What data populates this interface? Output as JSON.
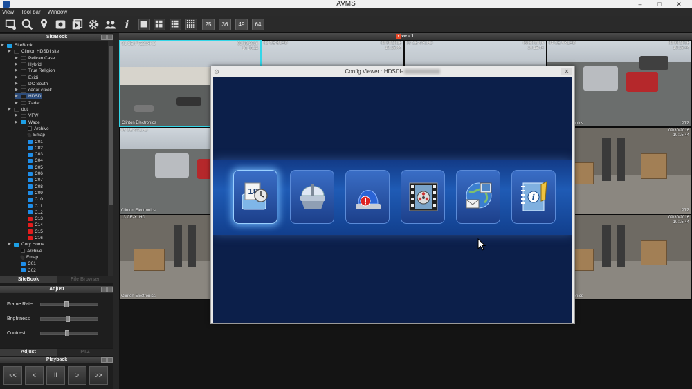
{
  "window": {
    "title": "AVMS",
    "controls": [
      "–",
      "□",
      "✕"
    ]
  },
  "menu": [
    "View",
    "Tool bar",
    "Window"
  ],
  "toolbar": {
    "icons": [
      "monitor-icon",
      "search-icon",
      "location-pin-icon",
      "archive-icon",
      "playback-icon",
      "gear-icon",
      "users-icon",
      "info-icon"
    ],
    "layout_counts": [
      "25",
      "36",
      "49",
      "64"
    ]
  },
  "sitebook": {
    "header": "SiteBook",
    "tree": [
      {
        "label": "SiteBook",
        "level": 0,
        "kind": "folder-blue"
      },
      {
        "label": "Clinton HDSDI site",
        "level": 1,
        "kind": "folder"
      },
      {
        "label": "Pelican Case",
        "level": 2,
        "kind": "folder"
      },
      {
        "label": "Hybrid",
        "level": 2,
        "kind": "folder"
      },
      {
        "label": "True Religion",
        "level": 2,
        "kind": "folder"
      },
      {
        "label": "Exidi",
        "level": 2,
        "kind": "folder"
      },
      {
        "label": "DC South",
        "level": 2,
        "kind": "folder"
      },
      {
        "label": "cedar creek",
        "level": 2,
        "kind": "folder"
      },
      {
        "label": "HDSDI",
        "level": 2,
        "kind": "folder",
        "selected": true
      },
      {
        "label": "Zadar",
        "level": 2,
        "kind": "folder"
      },
      {
        "label": "dot",
        "level": 1,
        "kind": "folder"
      },
      {
        "label": "VFW",
        "level": 2,
        "kind": "folder"
      },
      {
        "label": "Wade",
        "level": 2,
        "kind": "folder-blue"
      },
      {
        "label": "Archive",
        "level": 3,
        "kind": "archive"
      },
      {
        "label": "Emap",
        "level": 3,
        "kind": "pin"
      },
      {
        "label": "C01",
        "level": 3,
        "kind": "cam"
      },
      {
        "label": "C02",
        "level": 3,
        "kind": "cam"
      },
      {
        "label": "C03",
        "level": 3,
        "kind": "cam"
      },
      {
        "label": "C04",
        "level": 3,
        "kind": "cam"
      },
      {
        "label": "C05",
        "level": 3,
        "kind": "cam"
      },
      {
        "label": "C06",
        "level": 3,
        "kind": "cam"
      },
      {
        "label": "C07",
        "level": 3,
        "kind": "cam"
      },
      {
        "label": "C08",
        "level": 3,
        "kind": "cam"
      },
      {
        "label": "C09",
        "level": 3,
        "kind": "cam"
      },
      {
        "label": "C10",
        "level": 3,
        "kind": "cam"
      },
      {
        "label": "C11",
        "level": 3,
        "kind": "cam"
      },
      {
        "label": "C12",
        "level": 3,
        "kind": "cam"
      },
      {
        "label": "C13",
        "level": 3,
        "kind": "cam-red"
      },
      {
        "label": "C14",
        "level": 3,
        "kind": "cam-red"
      },
      {
        "label": "C15",
        "level": 3,
        "kind": "cam-red"
      },
      {
        "label": "C16",
        "level": 3,
        "kind": "cam-red"
      },
      {
        "label": "Cory Home",
        "level": 1,
        "kind": "folder-blue"
      },
      {
        "label": "Archive",
        "level": 2,
        "kind": "archive"
      },
      {
        "label": "Emap",
        "level": 2,
        "kind": "pin"
      },
      {
        "label": "C01",
        "level": 2,
        "kind": "cam"
      },
      {
        "label": "C02",
        "level": 2,
        "kind": "cam"
      }
    ],
    "tabs": [
      "SiteBook",
      "File Browser"
    ]
  },
  "adjust": {
    "header": "Adjust",
    "sliders": [
      {
        "label": "Frame Rate",
        "value": 0.45
      },
      {
        "label": "Brightness",
        "value": 0.48
      },
      {
        "label": "Contrast",
        "value": 0.46
      }
    ],
    "tabs": [
      "Adjust",
      "PTZ"
    ]
  },
  "playback": {
    "header": "Playback",
    "buttons": [
      "<<",
      "<",
      "II",
      ">",
      ">>"
    ]
  },
  "live": {
    "header": "Live - 1",
    "tiles": [
      {
        "name": "01 CE-PTZ30XHD",
        "date": "09/30/2016",
        "time": "10:15:44",
        "source": "Clinton Electronics",
        "ptz": "",
        "scene": "lot",
        "selected": true
      },
      {
        "name": "02 CE-B1HD",
        "date": "09/30/2016",
        "time": "10:15:44",
        "source": "",
        "ptz": "",
        "scene": "lot"
      },
      {
        "name": "03 CE-VX1HD",
        "date": "09/30/2016",
        "time": "10:15:44",
        "source": "",
        "ptz": "",
        "scene": "lot"
      },
      {
        "name": "04 CE-VX1HD",
        "date": "09/30/2016",
        "time": "10:15:44",
        "source": "Clinton Electronics",
        "ptz": "PTZ",
        "scene": "carpark"
      },
      {
        "name": "05 CE-VX1HD",
        "date": "",
        "time": "",
        "source": "Clinton Electronics",
        "ptz": "",
        "scene": "carpark"
      },
      {
        "name": "",
        "date": "",
        "time": "",
        "source": "",
        "ptz": "PTZ",
        "scene": "lot"
      },
      {
        "name": "09 ...",
        "date": "",
        "time": "",
        "source": "Clinton Electronics",
        "ptz": "",
        "scene": "grass"
      },
      {
        "name": "",
        "date": "09/30/2016",
        "time": "10:15:44",
        "source": "",
        "ptz": "PTZ",
        "scene": "warehouse"
      },
      {
        "name": "13 CE-X1HD",
        "date": "09/30/2016",
        "time": "10:15:44",
        "source": "Clinton Electronics",
        "ptz": "",
        "scene": "warehouse"
      },
      {
        "name": "",
        "date": "",
        "time": "",
        "source": "",
        "ptz": "PTZ",
        "scene": "warehouse"
      },
      {
        "name": "",
        "date": "",
        "time": "",
        "source": "Clinton Electronics",
        "ptz": "PTZ",
        "scene": "warehouse"
      },
      {
        "name": "",
        "date": "09/30/2016",
        "time": "10:15:44",
        "source": "Clinton Electronics",
        "ptz": "",
        "scene": "warehouse"
      }
    ]
  },
  "dialog": {
    "title": "Config Viewer : HDSDI-",
    "close": "✕",
    "items": [
      "schedule-icon",
      "camera-dome-icon",
      "alarm-icon",
      "video-reel-icon",
      "network-mail-icon",
      "info-manual-icon"
    ]
  }
}
